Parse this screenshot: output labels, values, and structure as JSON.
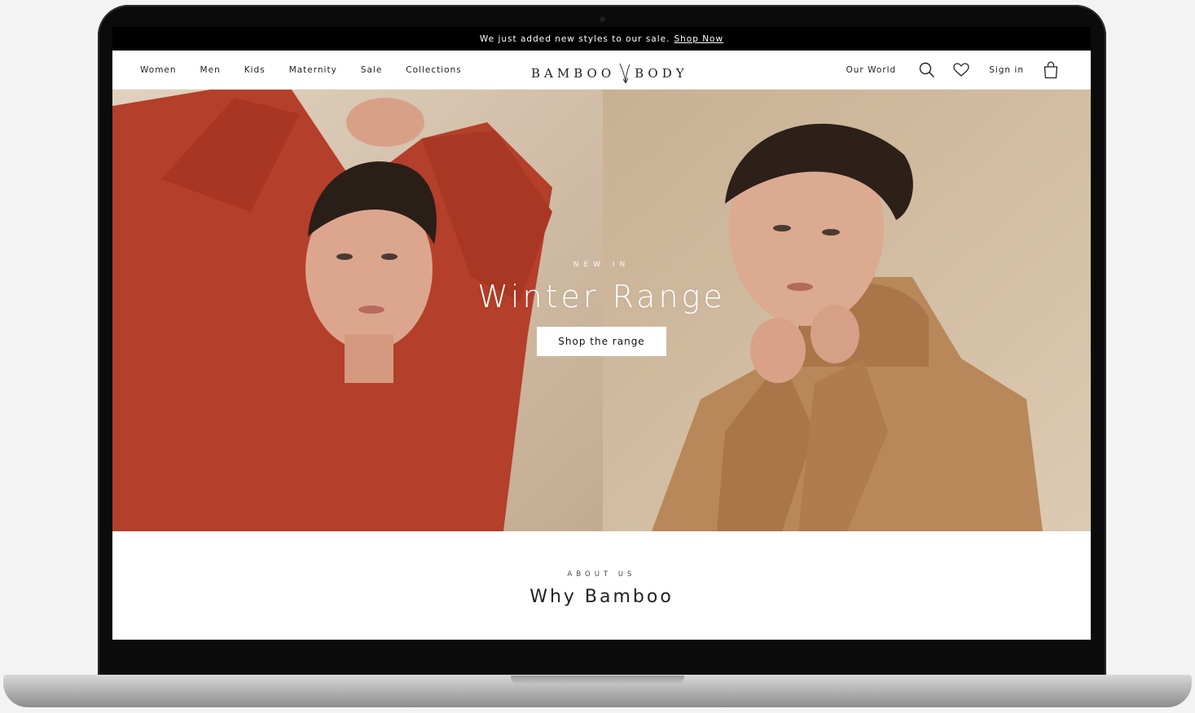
{
  "announcement": {
    "text": "We just added new styles to our sale.",
    "link_label": "Shop Now"
  },
  "nav": {
    "left": [
      "Women",
      "Men",
      "Kids",
      "Maternity",
      "Sale",
      "Collections"
    ],
    "logo_left": "BAMBOO",
    "logo_right": "BODY",
    "our_world": "Our World",
    "sign_in": "Sign in"
  },
  "hero": {
    "eyebrow": "NEW IN",
    "title": "Winter Range",
    "button": "Shop the range"
  },
  "about": {
    "eyebrow": "ABOUT US",
    "title": "Why Bamboo"
  },
  "colors": {
    "announce_bg": "#000000",
    "red_top": "#b8402b",
    "camel_knit": "#b88559"
  }
}
